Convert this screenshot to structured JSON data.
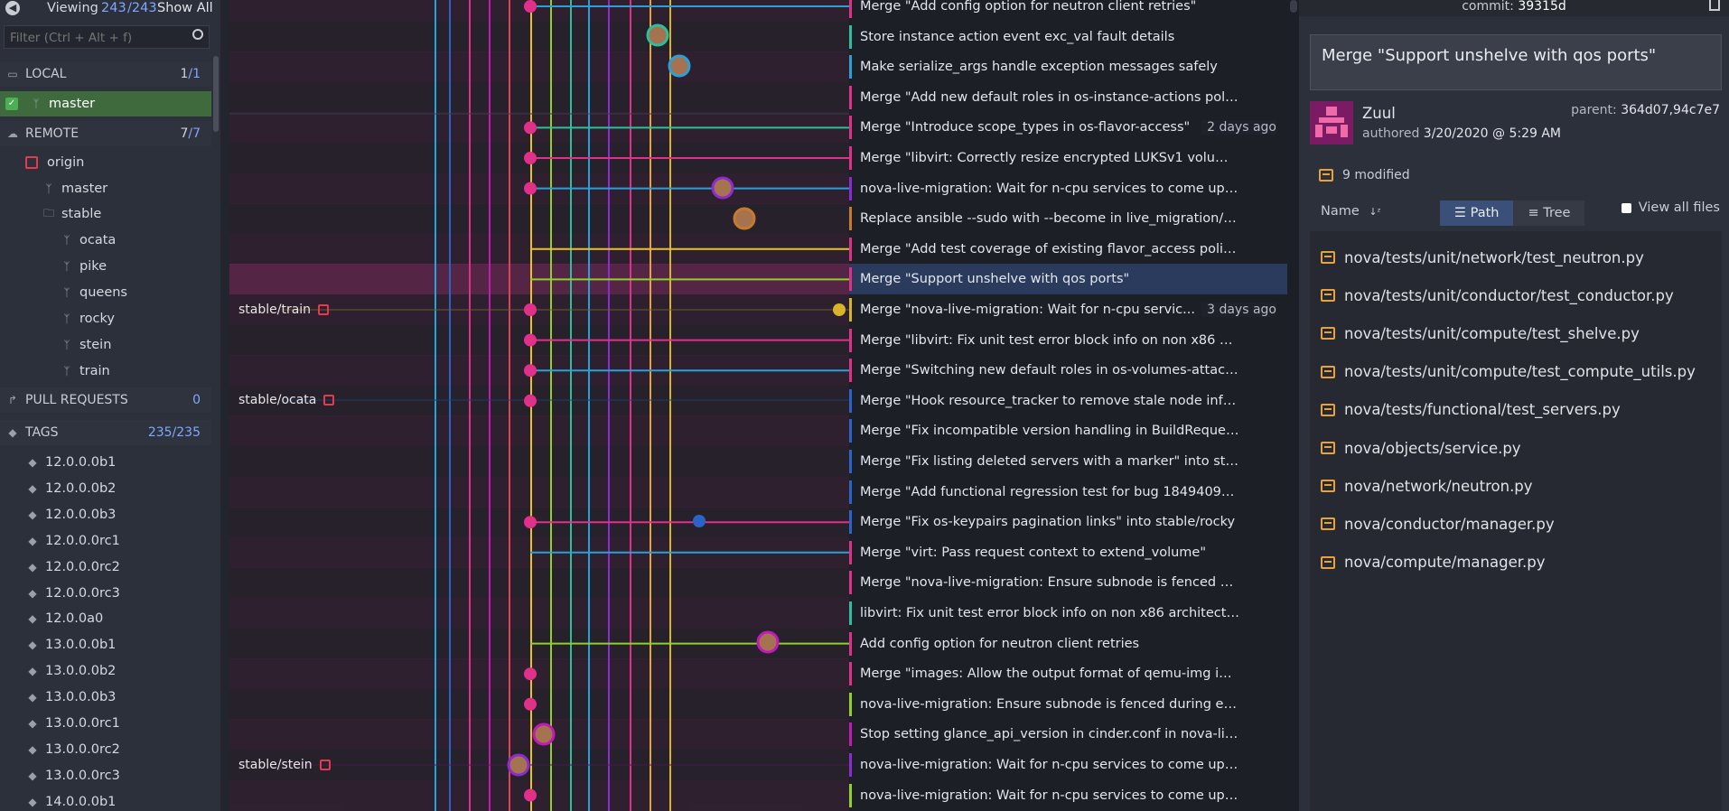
{
  "left": {
    "viewing_label": "Viewing",
    "viewing_count": "243",
    "viewing_total": "/243",
    "show_all": "Show All",
    "filter_placeholder": "Filter (Ctrl + Alt + f)",
    "local": {
      "label": "LOCAL",
      "count": "1",
      "total": "/1",
      "branch": "master"
    },
    "remote": {
      "label": "REMOTE",
      "count": "7",
      "total": "/7",
      "origin": "origin",
      "master": "master",
      "stable": "stable",
      "branches": [
        "ocata",
        "pike",
        "queens",
        "rocky",
        "stein",
        "train"
      ]
    },
    "pull_requests": {
      "label": "PULL REQUESTS",
      "count": "0"
    },
    "tags": {
      "label": "TAGS",
      "count": "235",
      "total": "/235",
      "items": [
        "12.0.0.0b1",
        "12.0.0.0b2",
        "12.0.0.0b3",
        "12.0.0.0rc1",
        "12.0.0.0rc2",
        "12.0.0.0rc3",
        "12.0.0a0",
        "13.0.0.0b1",
        "13.0.0.0b2",
        "13.0.0.0b3",
        "13.0.0.0rc1",
        "13.0.0.0rc2",
        "13.0.0.0rc3",
        "14.0.0.0b1"
      ]
    }
  },
  "graph": {
    "tags": [
      {
        "label": "stable/train",
        "color": "#6b5a2a"
      },
      {
        "label": "stable/ocata",
        "color": "#1f3b66"
      },
      {
        "label": "stable/stein",
        "color": "#4a1c4c"
      }
    ]
  },
  "commits": [
    {
      "message": "Merge \"Add config option for neutron client retries\"",
      "time": "",
      "bar": "#e0308a"
    },
    {
      "message": "Store instance action event exc_val fault details",
      "time": "",
      "bar": "#2bbf9b"
    },
    {
      "message": "Make serialize_args handle exception messages safely",
      "time": "",
      "bar": "#2aa0d8"
    },
    {
      "message": "Merge \"Add new default roles in os-instance-actions policies\"",
      "time": "",
      "bar": "#e0308a"
    },
    {
      "message": "Merge \"Introduce scope_types in os-flavor-access\"",
      "time": "2 days ago",
      "bar": "#e0308a"
    },
    {
      "message": "Merge \"libvirt: Correctly resize encrypted LUKSv1 volumes\"",
      "time": "",
      "bar": "#e0308a"
    },
    {
      "message": "nova-live-migration: Wait for n-cpu services to come up after...",
      "time": "",
      "bar": "#8d2bd0"
    },
    {
      "message": "Replace ansible --sudo with --become in live_migration/hook...",
      "time": "",
      "bar": "#c77a2b"
    },
    {
      "message": "Merge \"Add test coverage of existing flavor_access policies\"",
      "time": "",
      "bar": "#e0308a"
    },
    {
      "message": "Merge \"Support unshelve with qos ports\"",
      "time": "",
      "bar": "#e0308a",
      "selected": true
    },
    {
      "message": "Merge \"nova-live-migration: Wait for n-cpu servic...",
      "time": "3 days ago",
      "bar": "#d8b42a"
    },
    {
      "message": "Merge \"libvirt: Fix unit test error block info on non x86 archit...",
      "time": "",
      "bar": "#e0308a"
    },
    {
      "message": "Merge \"Switching new default roles in os-volumes-attachme...",
      "time": "",
      "bar": "#e0308a"
    },
    {
      "message": "Merge \"Hook resource_tracker to remove stale node inform...",
      "time": "",
      "bar": "#2a64c8"
    },
    {
      "message": "Merge \"Fix incompatible version handling in BuildRequest\" i...",
      "time": "",
      "bar": "#2a64c8"
    },
    {
      "message": "Merge \"Fix listing deleted servers with a marker\" into stable/...",
      "time": "",
      "bar": "#2a64c8"
    },
    {
      "message": "Merge \"Add functional regression test for bug 1849409\" into...",
      "time": "",
      "bar": "#2a64c8"
    },
    {
      "message": "Merge \"Fix os-keypairs pagination links\" into stable/rocky",
      "time": "",
      "bar": "#2a64c8"
    },
    {
      "message": "Merge \"virt: Pass request context to extend_volume\"",
      "time": "",
      "bar": "#e0308a"
    },
    {
      "message": "Merge \"nova-live-migration: Ensure subnode is fenced durin...",
      "time": "",
      "bar": "#e0308a"
    },
    {
      "message": "libvirt: Fix unit test error block info on non x86 architecture",
      "time": "",
      "bar": "#2bbf9b"
    },
    {
      "message": "Add config option for neutron client retries",
      "time": "",
      "bar": "#e0308a"
    },
    {
      "message": "Merge \"images: Allow the output format of qemu-img info t...",
      "time": "",
      "bar": "#e0308a"
    },
    {
      "message": "nova-live-migration: Ensure subnode is fenced during evacu...",
      "time": "",
      "bar": "#8fd12b"
    },
    {
      "message": "Stop setting glance_api_version in cinder.conf in nova-live-m...",
      "time": "",
      "bar": "#c21ab8"
    },
    {
      "message": "nova-live-migration: Wait for n-cpu services to come up after...",
      "time": "",
      "bar": "#8d2bd0"
    },
    {
      "message": "nova-live-migration: Wait for n-cpu services to come up after...",
      "time": "",
      "bar": "#8fd12b"
    }
  ],
  "detail": {
    "commit_label": "commit:",
    "commit_sha": "39315d",
    "message": "Merge \"Support unshelve with qos ports\"",
    "author": "Zuul",
    "authored_label": "authored",
    "authored_date": "3/20/2020 @ 5:29 AM",
    "parent_label": "parent:",
    "parent_shas": "364d07,94c7e7",
    "modified": "9 modified",
    "sort_label": "Name",
    "path_label": "Path",
    "tree_label": "Tree",
    "view_all_label": "View all files",
    "files": [
      "nova/tests/unit/network/test_neutron.py",
      "nova/tests/unit/conductor/test_conductor.py",
      "nova/tests/unit/compute/test_shelve.py",
      "nova/tests/unit/compute/test_compute_utils.py",
      "nova/tests/functional/test_servers.py",
      "nova/objects/service.py",
      "nova/network/neutron.py",
      "nova/conductor/manager.py",
      "nova/compute/manager.py"
    ]
  }
}
